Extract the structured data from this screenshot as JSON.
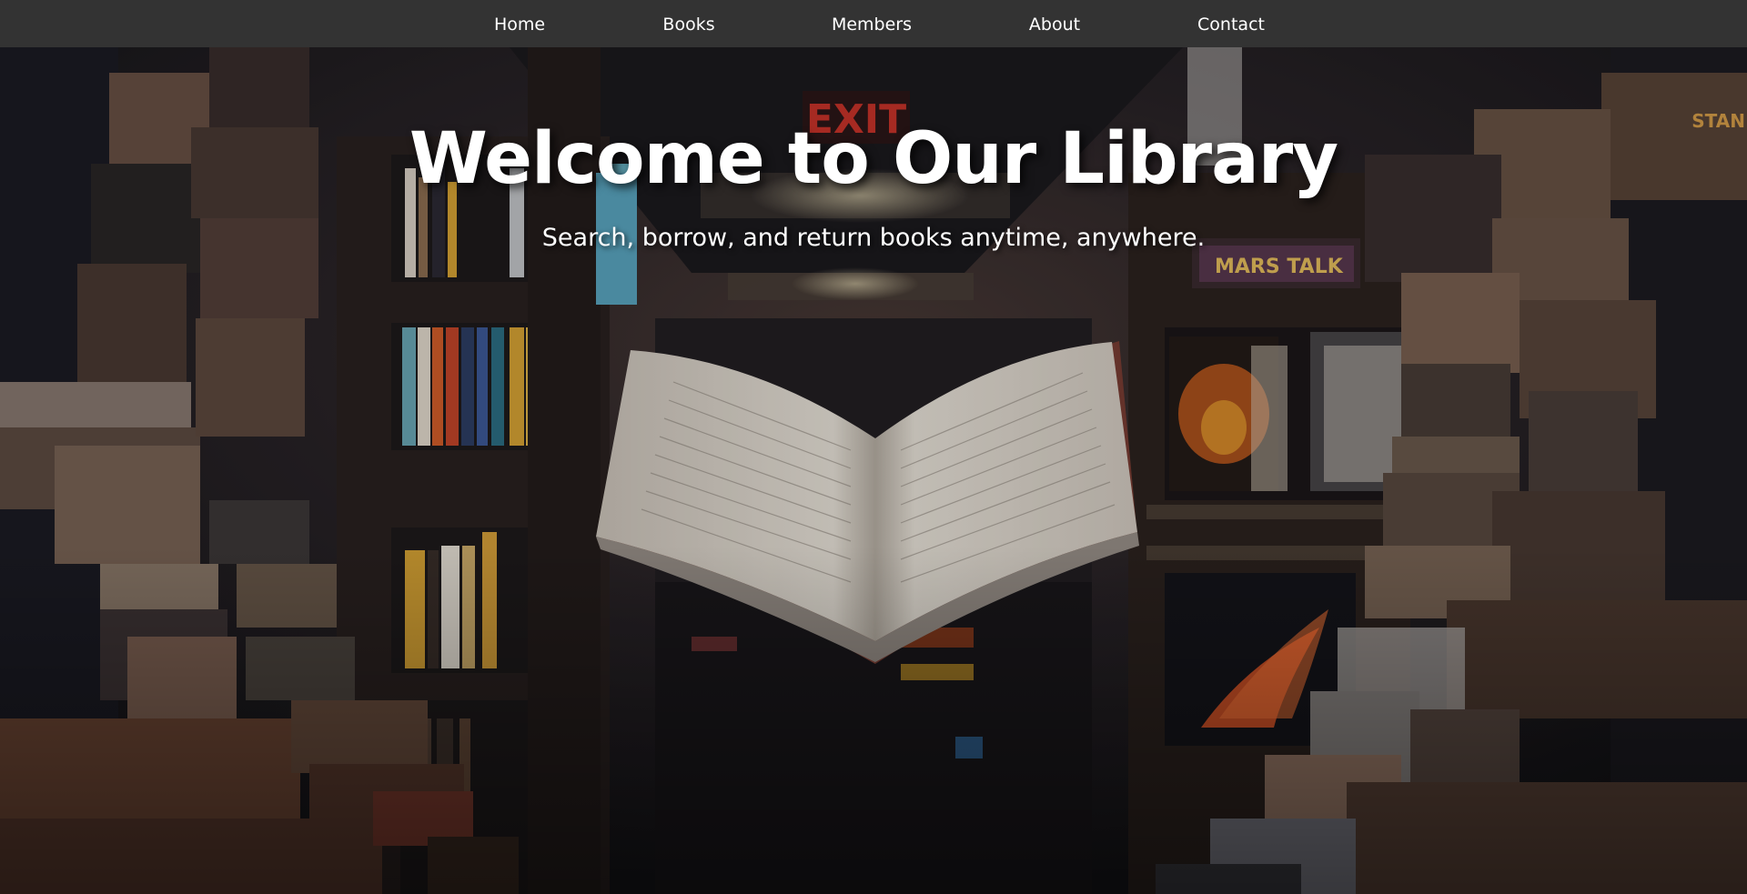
{
  "nav": {
    "items": [
      {
        "label": "Home"
      },
      {
        "label": "Books"
      },
      {
        "label": "Members"
      },
      {
        "label": "About"
      },
      {
        "label": "Contact"
      }
    ]
  },
  "hero": {
    "title": "Welcome to Our Library",
    "subtitle": "Search, borrow, and return books anytime, anywhere.",
    "sign_text": "EXIT",
    "poster_text": "MARS TALK",
    "spine_text": "STAN"
  },
  "colors": {
    "navbar_bg": "#333333",
    "nav_text": "#ffffff",
    "exit_sign": "#e83a2e"
  }
}
